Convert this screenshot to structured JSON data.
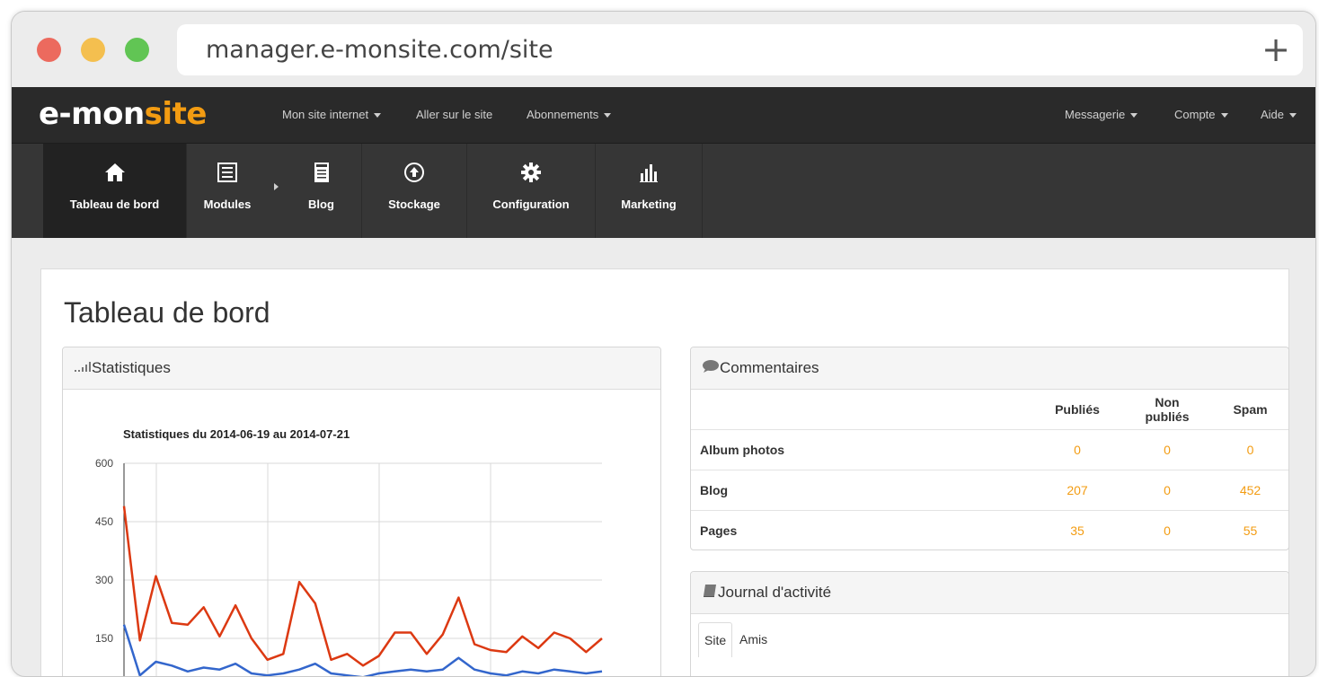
{
  "browser": {
    "url": "manager.e-monsite.com/site",
    "new_tab_label": "+"
  },
  "logo": {
    "part1": "e-mon",
    "part2": "site"
  },
  "topnav": {
    "left": [
      "Mon site internet",
      "Aller sur le site",
      "Abonnements"
    ],
    "right": [
      "Messagerie",
      "Compte",
      "Aide"
    ]
  },
  "iconbar": {
    "tabs": [
      {
        "label": "Tableau de bord",
        "icon": "home-icon"
      },
      {
        "label": "Modules",
        "icon": "list-icon"
      },
      {
        "label": "Blog",
        "icon": "document-icon"
      },
      {
        "label": "Stockage",
        "icon": "upload-icon"
      },
      {
        "label": "Configuration",
        "icon": "gear-icon"
      },
      {
        "label": "Marketing",
        "icon": "bar-chart-icon"
      }
    ]
  },
  "page": {
    "title": "Tableau de bord"
  },
  "stats": {
    "panel_title": "Statistiques",
    "chart_title": "Statistiques du 2014-06-19 au 2014-07-21"
  },
  "comments": {
    "panel_title": "Commentaires",
    "headers": [
      "Publiés",
      "Non publiés",
      "Spam"
    ],
    "rows": [
      {
        "name": "Album photos",
        "published": "0",
        "unpublished": "0",
        "spam": "0"
      },
      {
        "name": "Blog",
        "published": "207",
        "unpublished": "0",
        "spam": "452"
      },
      {
        "name": "Pages",
        "published": "35",
        "unpublished": "0",
        "spam": "55"
      }
    ]
  },
  "journal": {
    "panel_title": "Journal d'activité",
    "tabs": [
      "Site",
      "Amis"
    ]
  },
  "colors": {
    "accent": "#f39c12",
    "red_series": "#dc3912",
    "blue_series": "#3366cc"
  },
  "chart_data": {
    "type": "line",
    "title": "Statistiques du 2014-06-19 au 2014-07-21",
    "yticks": [
      600,
      450,
      300,
      150
    ],
    "ylim": [
      0,
      600
    ],
    "series": [
      {
        "values": [
          490,
          145,
          310,
          190,
          185,
          230,
          155,
          235,
          150,
          95,
          110,
          295,
          240,
          95,
          110,
          80,
          105,
          165,
          165,
          110,
          160,
          255,
          135,
          120,
          115,
          155,
          125,
          165,
          150,
          115,
          150
        ]
      },
      {
        "values": [
          185,
          55,
          90,
          80,
          65,
          75,
          70,
          85,
          60,
          55,
          60,
          70,
          85,
          60,
          55,
          50,
          60,
          65,
          70,
          65,
          70,
          100,
          70,
          60,
          55,
          65,
          60,
          70,
          65,
          60,
          65
        ]
      }
    ]
  }
}
